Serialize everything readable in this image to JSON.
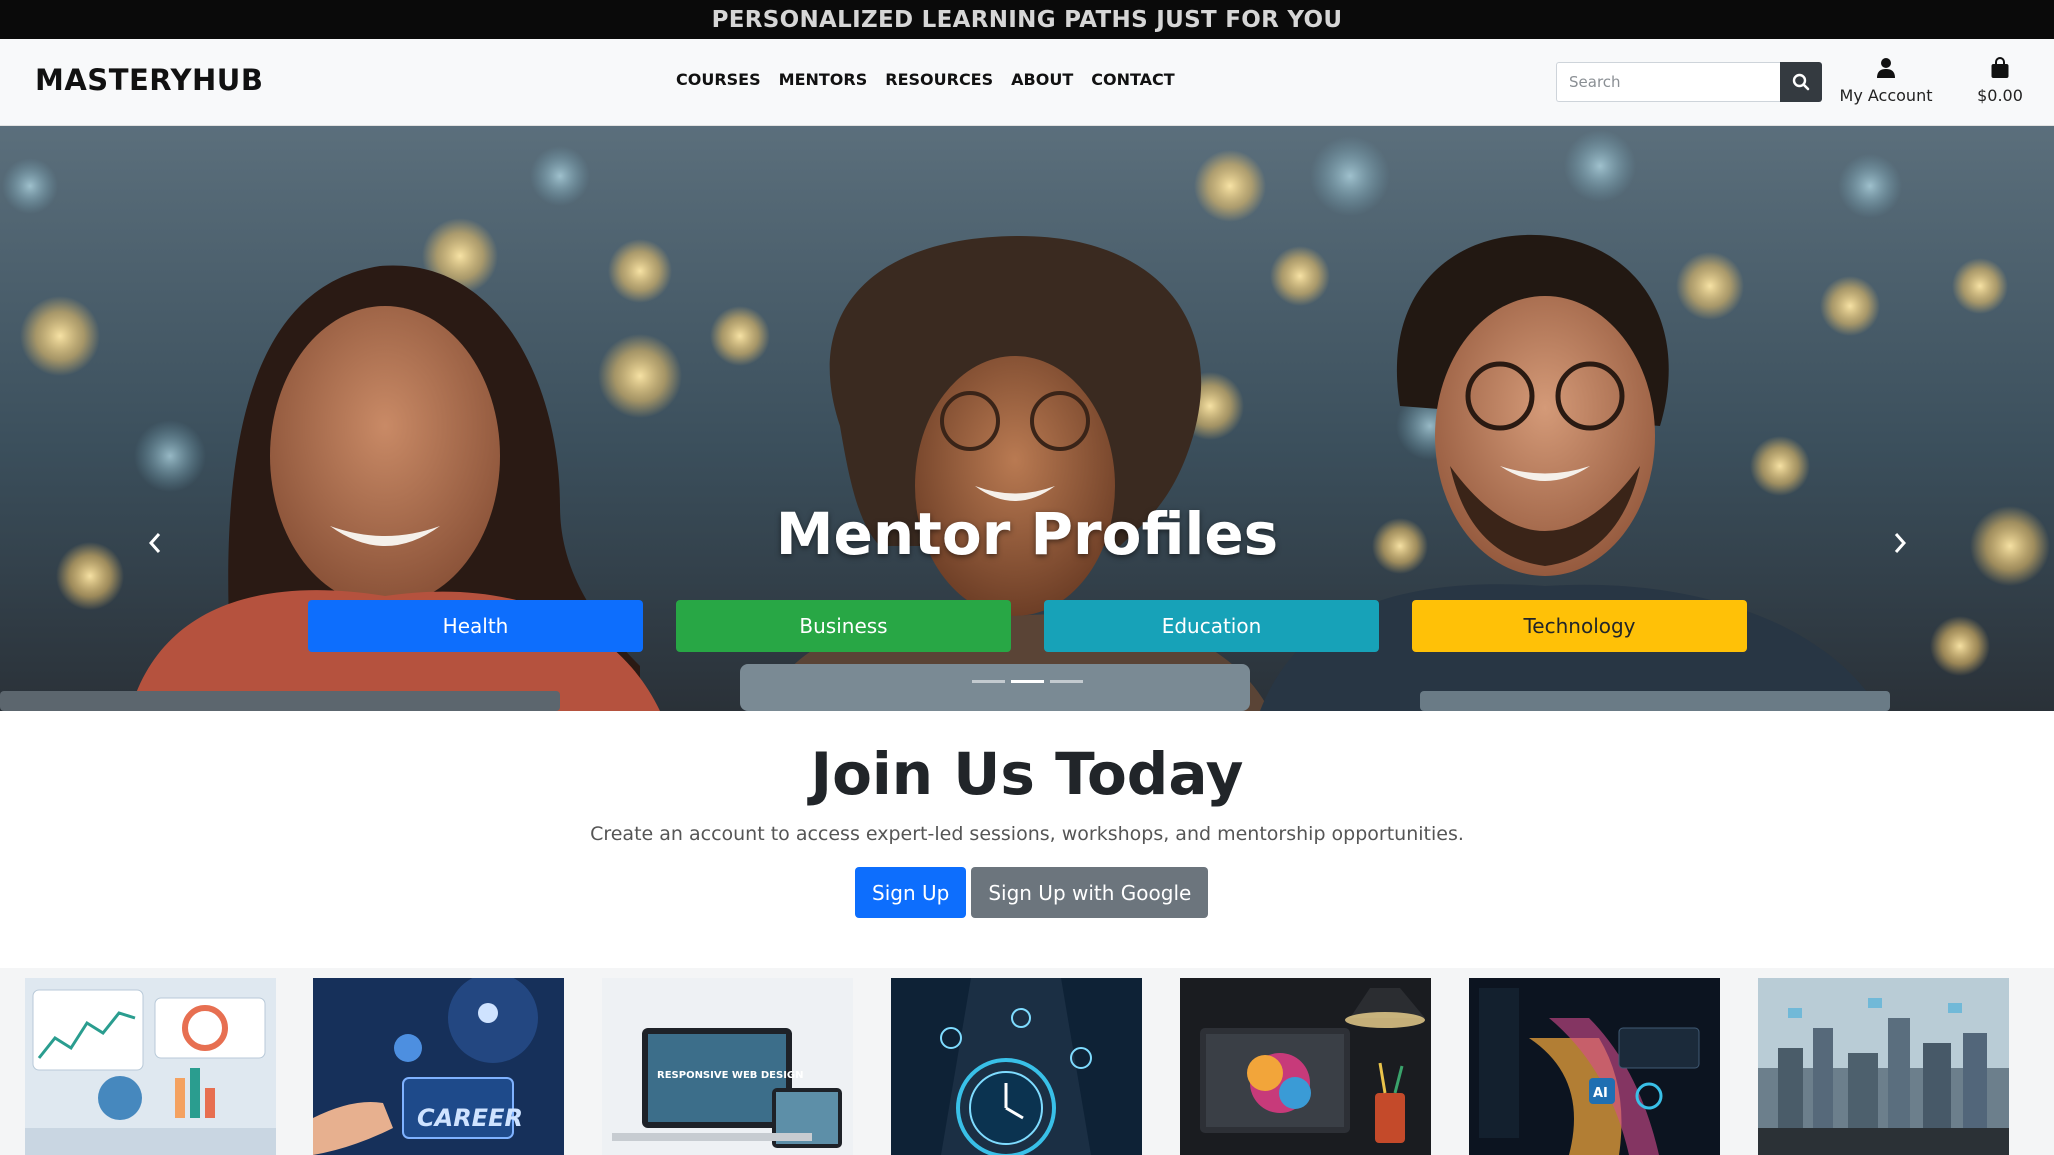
{
  "banner": {
    "text": "PERSONALIZED LEARNING PATHS JUST FOR YOU"
  },
  "brand": {
    "name": "MASTERYHUB"
  },
  "nav": {
    "items": [
      "COURSES",
      "MENTORS",
      "RESOURCES",
      "ABOUT",
      "CONTACT"
    ]
  },
  "search": {
    "placeholder": "Search",
    "icon": "search-icon"
  },
  "account": {
    "label": "My Account",
    "icon": "user-icon"
  },
  "cart": {
    "total": "$0.00",
    "icon": "shopping-bag-icon"
  },
  "hero": {
    "title": "Mentor Profiles",
    "prev_icon": "chevron-left-icon",
    "next_icon": "chevron-right-icon",
    "categories": [
      {
        "label": "Health",
        "color": "#0d6efd",
        "text_color": "#ffffff"
      },
      {
        "label": "Business",
        "color": "#28a745",
        "text_color": "#ffffff"
      },
      {
        "label": "Education",
        "color": "#17a2b8",
        "text_color": "#ffffff"
      },
      {
        "label": "Technology",
        "color": "#ffc107",
        "text_color": "#212529"
      }
    ],
    "slides_count": 3,
    "active_slide": 2
  },
  "join": {
    "title": "Join Us Today",
    "subtitle": "Create an account to access expert-led sessions, workshops, and mentorship opportunities.",
    "signup_label": "Sign Up",
    "google_label": "Sign Up with Google"
  },
  "thumbnails": [
    {
      "name": "analytics-dashboard-image"
    },
    {
      "name": "career-image",
      "caption": "CAREER"
    },
    {
      "name": "responsive-web-design-image",
      "caption": "RESPONSIVE WEB DESIGN"
    },
    {
      "name": "time-management-image"
    },
    {
      "name": "creative-workspace-image"
    },
    {
      "name": "ai-data-image",
      "caption": "AI"
    },
    {
      "name": "city-network-image"
    }
  ],
  "colors": {
    "banner_bg": "#0a0a0a",
    "navbar_bg": "#f8f9fa",
    "primary": "#0d6efd",
    "secondary": "#6c757d"
  }
}
